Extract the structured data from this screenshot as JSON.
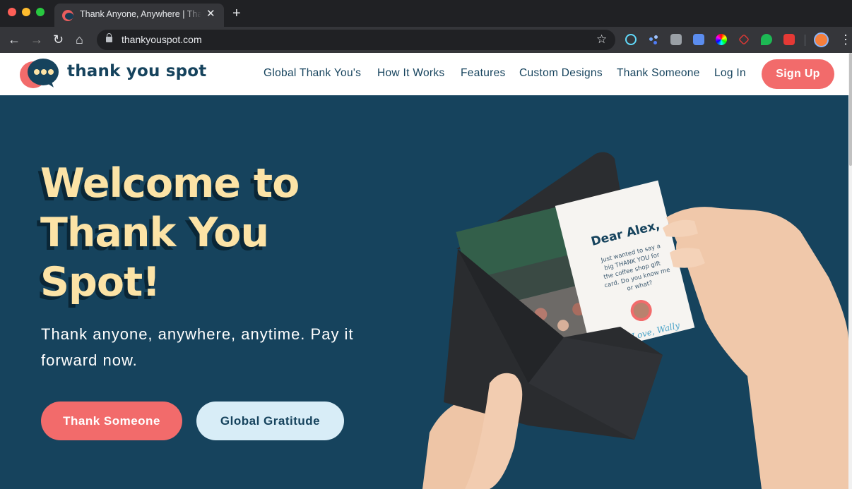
{
  "browser": {
    "tab_title": "Thank Anyone, Anywhere | Thank You Spot",
    "tab_close": "✕",
    "new_tab": "+",
    "url": "thankyouspot.com",
    "back": "←",
    "forward": "→",
    "reload": "↻",
    "home": "⌂",
    "star": "☆",
    "menu": "⋮"
  },
  "site": {
    "logo_text": "thank you spot",
    "nav": {
      "global": "Global Thank You's",
      "how": "How It Works",
      "features": "Features",
      "custom": "Custom Designs",
      "thank": "Thank Someone",
      "login": "Log In",
      "signup": "Sign Up"
    }
  },
  "hero": {
    "title_lines": [
      "Welcome to",
      "Thank You",
      "Spot!"
    ],
    "subtitle": "Thank anyone, anywhere, anytime. Pay it forward now.",
    "cta_primary": "Thank Someone",
    "cta_secondary": "Global Gratitude"
  },
  "card": {
    "greeting": "Dear Alex,",
    "message_lines": [
      "Just wanted to say a",
      "big THANK YOU for",
      "the coffee shop gift",
      "card. Do you know me",
      "or what?"
    ],
    "signature": "Love, Wally"
  },
  "colors": {
    "brand_navy": "#16435d",
    "brand_coral": "#f26b6b",
    "brand_cream": "#fce3a6",
    "light_blue": "#d8edf7"
  },
  "icons": {
    "lock": "lock-icon",
    "star": "star-icon",
    "menu": "kebab-menu-icon"
  }
}
